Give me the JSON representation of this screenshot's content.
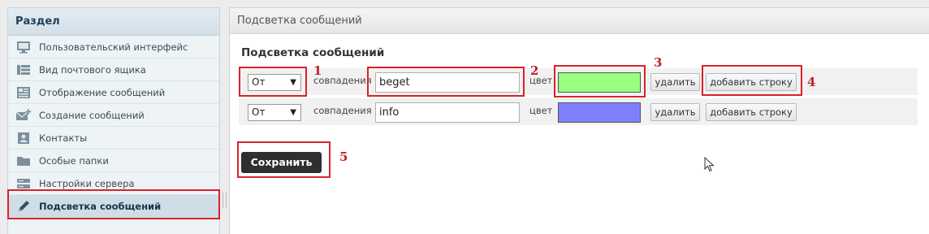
{
  "sidebar": {
    "title": "Раздел",
    "items": [
      {
        "label": "Пользовательский интерфейс",
        "icon": "monitor-icon"
      },
      {
        "label": "Вид почтового ящика",
        "icon": "mailbox-layout-icon"
      },
      {
        "label": "Отображение сообщений",
        "icon": "message-view-icon"
      },
      {
        "label": "Создание сообщений",
        "icon": "compose-icon"
      },
      {
        "label": "Контакты",
        "icon": "contacts-icon"
      },
      {
        "label": "Особые папки",
        "icon": "folder-icon"
      },
      {
        "label": "Настройки сервера",
        "icon": "server-icon"
      },
      {
        "label": "Подсветка сообщений",
        "icon": "pencil-icon",
        "active": true
      }
    ]
  },
  "main": {
    "header": "Подсветка сообщений",
    "section_title": "Подсветка сообщений",
    "rules": [
      {
        "field": "От",
        "match_label": "совпадения",
        "value": "beget",
        "color_label": "цвет",
        "color": "#99ff80",
        "delete_label": "удалить",
        "add_label": "добавить строку"
      },
      {
        "field": "От",
        "match_label": "совпадения",
        "value": "info",
        "color_label": "цвет",
        "color": "#8080ff",
        "delete_label": "удалить",
        "add_label": "добавить строку"
      }
    ],
    "save_label": "Сохранить"
  },
  "annotations": [
    "1",
    "2",
    "3",
    "4",
    "5"
  ],
  "colors": {
    "annotation": "#d8232a",
    "active_item": "#cfdde6"
  }
}
